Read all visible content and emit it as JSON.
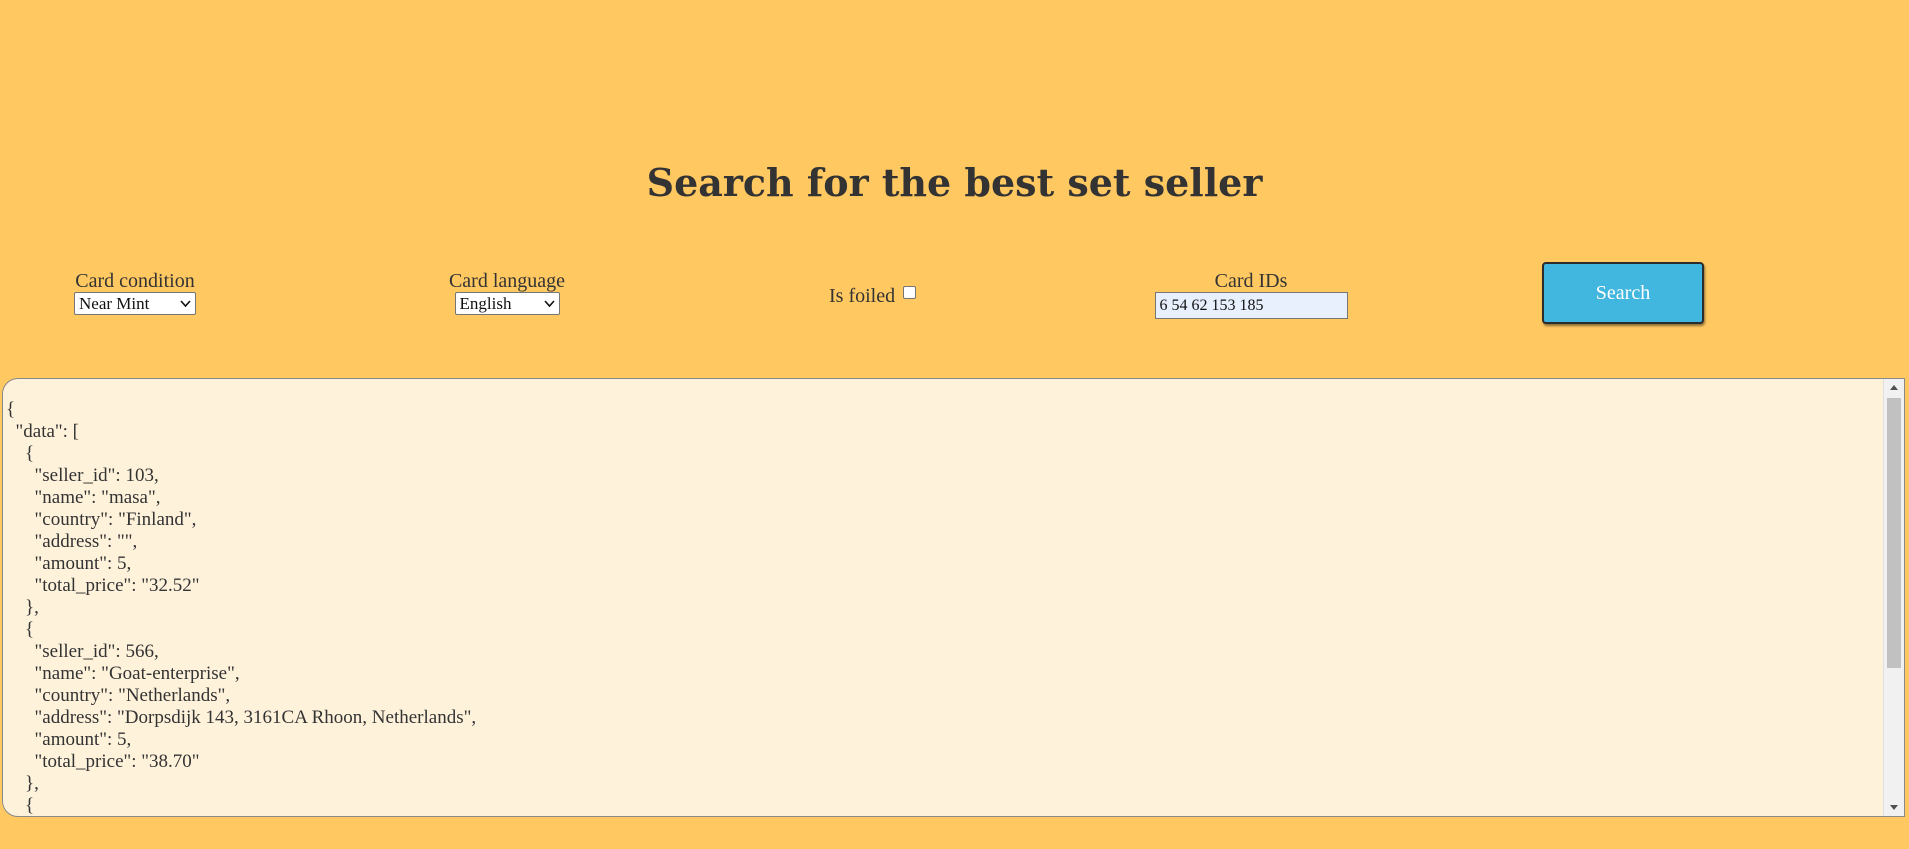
{
  "page": {
    "title": "Search for the best set seller"
  },
  "form": {
    "condition": {
      "label": "Card condition",
      "selected": "Near Mint"
    },
    "language": {
      "label": "Card language",
      "selected": "English"
    },
    "foiled": {
      "label": "Is foiled",
      "checked": false
    },
    "card_ids": {
      "label": "Card IDs",
      "value": "6 54 62 153 185"
    },
    "search_label": "Search"
  },
  "output": {
    "text": "{\n  \"data\": [\n    {\n      \"seller_id\": 103,\n      \"name\": \"masa\",\n      \"country\": \"Finland\",\n      \"address\": \"\",\n      \"amount\": 5,\n      \"total_price\": \"32.52\"\n    },\n    {\n      \"seller_id\": 566,\n      \"name\": \"Goat-enterprise\",\n      \"country\": \"Netherlands\",\n      \"address\": \"Dorpsdijk 143, 3161CA Rhoon, Netherlands\",\n      \"amount\": 5,\n      \"total_price\": \"38.70\"\n    },\n    {"
  },
  "colors": {
    "background": "#FFC861",
    "output_background": "#FEF2DB",
    "button": "#41B6DE",
    "text": "#333333"
  }
}
